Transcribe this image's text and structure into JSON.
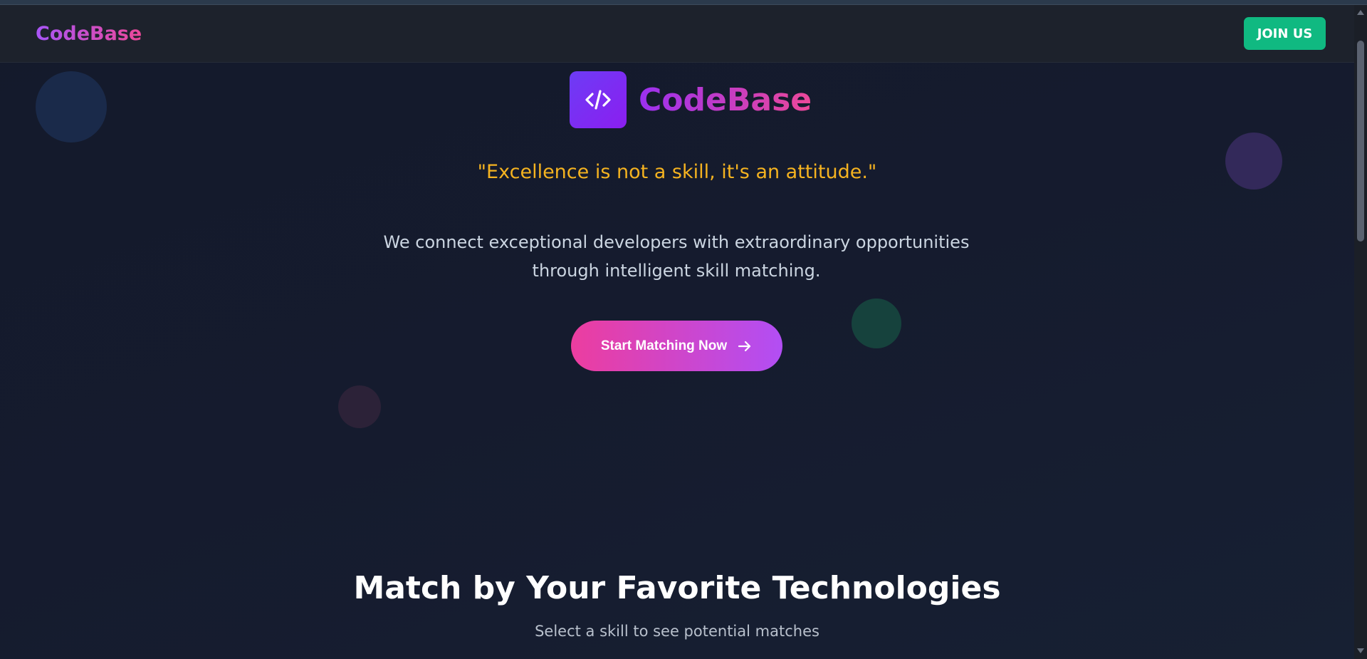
{
  "navbar": {
    "brand": "CodeBase",
    "join_label": "JOIN US"
  },
  "hero": {
    "brand": "CodeBase",
    "logo_icon": "code-brackets-icon",
    "quote": "\"Excellence is not a skill, it's an attitude.\"",
    "description": "We connect exceptional developers with extraordinary opportunities through intelligent skill matching.",
    "cta_label": "Start Matching Now",
    "cta_icon": "arrow-right-icon"
  },
  "skills_section": {
    "title": "Match by Your Favorite Technologies",
    "subtitle": "Select a skill to see potential matches"
  },
  "colors": {
    "accent_purple": "#a855f7",
    "accent_pink": "#ec4899",
    "join_green": "#10b981",
    "quote_amber": "#f5b320"
  }
}
